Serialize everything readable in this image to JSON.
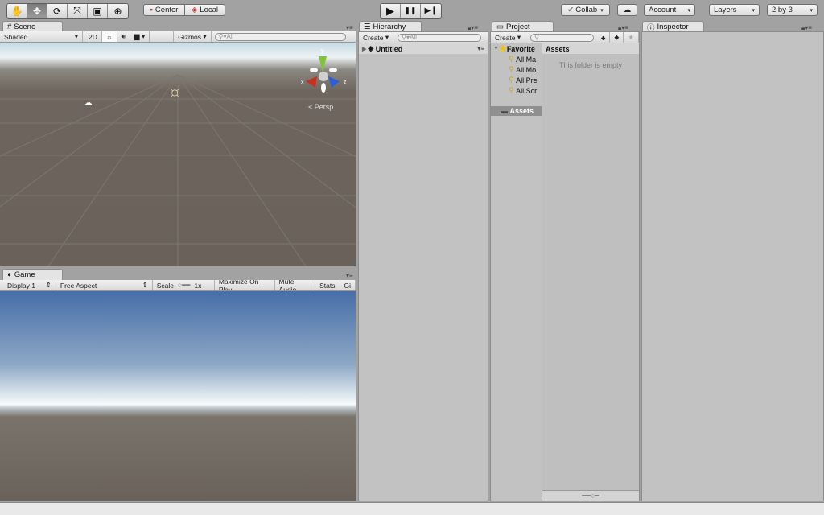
{
  "toolbar": {
    "tools": [
      "hand-tool",
      "move-tool",
      "rotate-tool",
      "scale-tool",
      "rect-tool",
      "transform-tool"
    ],
    "tool_glyphs": [
      "✋",
      "✥",
      "⟳",
      "⤧",
      "▣",
      "⊕"
    ],
    "active_tool": "move-tool",
    "pivot": "Center",
    "space": "Local",
    "play": "▶",
    "pause": "❚❚",
    "step": "▶❙",
    "collab": "Collab",
    "account": "Account",
    "layers": "Layers",
    "layout": "2 by 3"
  },
  "scene": {
    "tab": "Scene",
    "shading": "Shaded",
    "mode_2d": "2D",
    "gizmos": "Gizmos",
    "search_placeholder": "All",
    "persp": "Persp",
    "axis": {
      "x": "x",
      "y": "y",
      "z": "z"
    }
  },
  "game": {
    "tab": "Game",
    "display": "Display 1",
    "aspect": "Free Aspect",
    "scale_label": "Scale",
    "scale_value": "1x",
    "maximize": "Maximize On Play",
    "mute": "Mute Audio",
    "stats": "Stats",
    "gizmos": "Gi"
  },
  "hierarchy": {
    "tab": "Hierarchy",
    "create": "Create",
    "search_placeholder": "All",
    "scene_name": "Untitled"
  },
  "project": {
    "tab": "Project",
    "create": "Create",
    "favorites_label": "Favorite",
    "favorites": [
      "All Ma",
      "All Mo",
      "All Pre",
      "All Scr"
    ],
    "assets_folder": "Assets",
    "breadcrumb": "Assets",
    "empty_message": "This folder is empty"
  },
  "inspector": {
    "tab": "Inspector"
  }
}
